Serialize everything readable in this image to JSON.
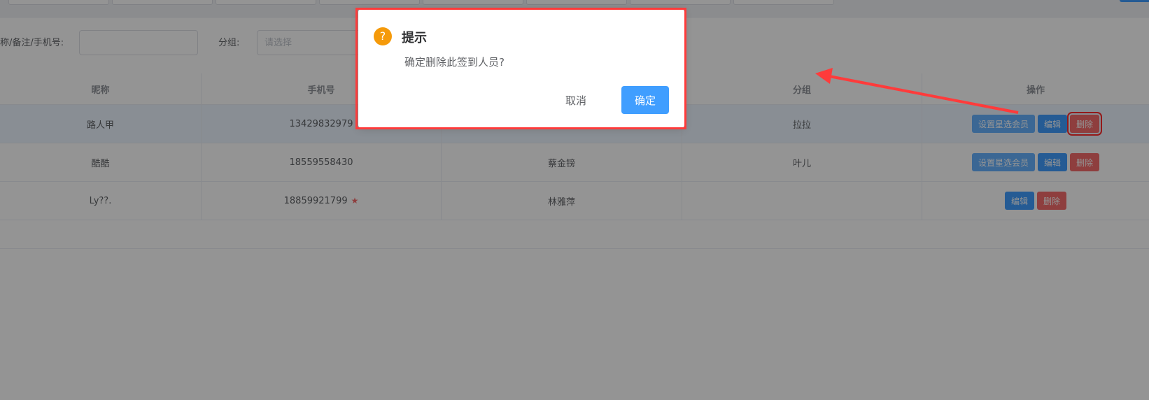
{
  "filters": {
    "name_label": "称/备注/手机号:",
    "group_label": "分组:",
    "group_placeholder": "请选择"
  },
  "table": {
    "headers": [
      "昵称",
      "手机号",
      "",
      "分组",
      "操作"
    ],
    "rows": [
      {
        "nickname": "路人甲",
        "phone": "13429832979",
        "name": "",
        "group": "拉拉"
      },
      {
        "nickname": "酷酷",
        "phone": "18559558430",
        "name": "蔡金镑",
        "group": "叶儿"
      },
      {
        "nickname": "Ly??.",
        "phone": "18859921799",
        "name": "林雅萍",
        "group": ""
      }
    ],
    "actions": {
      "set_star_label": "设置星选会员",
      "edit_label": "编辑",
      "delete_label": "删除"
    }
  },
  "dialog": {
    "title": "提示",
    "message": "确定删除此签到人员?",
    "cancel_label": "取消",
    "confirm_label": "确定",
    "icon": "question-icon"
  },
  "colors": {
    "accent": "#409eff",
    "danger": "#f56c6c",
    "warning": "#f59a0a",
    "highlight": "#ff3b3b"
  }
}
